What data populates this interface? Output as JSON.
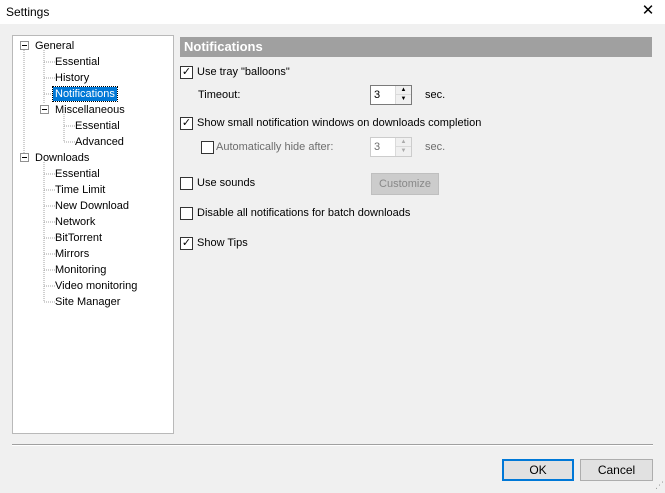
{
  "window": {
    "title": "Settings",
    "close_glyph": "✕"
  },
  "tree": {
    "items": [
      {
        "label": "General",
        "level": 0
      },
      {
        "label": "Essential",
        "level": 1
      },
      {
        "label": "History",
        "level": 1
      },
      {
        "label": "Notifications",
        "level": 1,
        "selected": true
      },
      {
        "label": "Miscellaneous",
        "level": 1
      },
      {
        "label": "Essential",
        "level": 2
      },
      {
        "label": "Advanced",
        "level": 2
      },
      {
        "label": "Downloads",
        "level": 0
      },
      {
        "label": "Essential",
        "level": 1
      },
      {
        "label": "Time Limit",
        "level": 1
      },
      {
        "label": "New Download",
        "level": 1
      },
      {
        "label": "Network",
        "level": 1
      },
      {
        "label": "BitTorrent",
        "level": 1
      },
      {
        "label": "Mirrors",
        "level": 1
      },
      {
        "label": "Monitoring",
        "level": 1
      },
      {
        "label": "Video monitoring",
        "level": 1
      },
      {
        "label": "Site Manager",
        "level": 1
      }
    ]
  },
  "panel": {
    "header": "Notifications",
    "use_tray": {
      "label": "Use tray \"balloons\"",
      "checked": true
    },
    "timeout": {
      "label": "Timeout:",
      "value": "3",
      "unit": "sec."
    },
    "show_small": {
      "label": "Show small notification windows on downloads completion",
      "checked": true
    },
    "auto_hide": {
      "label": "Automatically hide after:",
      "checked": false,
      "value": "3",
      "unit": "sec."
    },
    "use_sounds": {
      "label": "Use sounds",
      "checked": false
    },
    "customize_button": "Customize",
    "disable_batch": {
      "label": "Disable all notifications for batch downloads",
      "checked": false
    },
    "show_tips": {
      "label": "Show Tips",
      "checked": true
    }
  },
  "buttons": {
    "ok": "OK",
    "cancel": "Cancel"
  }
}
